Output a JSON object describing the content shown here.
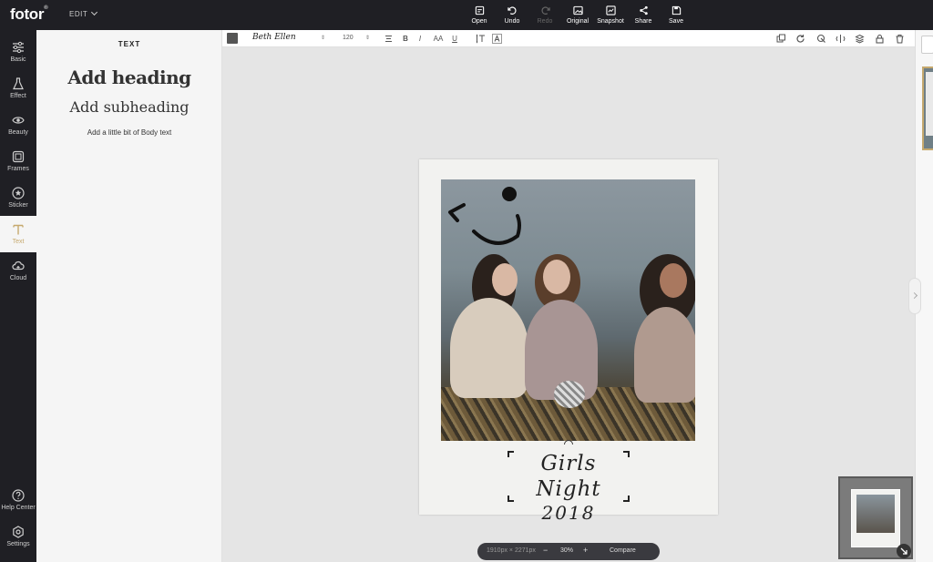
{
  "app": {
    "logo": "fotor",
    "logo_mark": "®",
    "mode_menu": "EDIT"
  },
  "toolbar": [
    {
      "label": "Open",
      "icon": "open-icon",
      "enabled": true
    },
    {
      "label": "Undo",
      "icon": "undo-icon",
      "enabled": true
    },
    {
      "label": "Redo",
      "icon": "redo-icon",
      "enabled": false
    },
    {
      "label": "Original",
      "icon": "original-icon",
      "enabled": true
    },
    {
      "label": "Snapshot",
      "icon": "snapshot-icon",
      "enabled": true
    },
    {
      "label": "Share",
      "icon": "share-icon",
      "enabled": true
    },
    {
      "label": "Save",
      "icon": "save-icon",
      "enabled": true
    }
  ],
  "sidebar": {
    "items": [
      {
        "label": "Basic",
        "icon": "sliders-icon"
      },
      {
        "label": "Effect",
        "icon": "flask-icon"
      },
      {
        "label": "Beauty",
        "icon": "eye-icon"
      },
      {
        "label": "Frames",
        "icon": "frame-icon"
      },
      {
        "label": "Sticker",
        "icon": "star-icon"
      },
      {
        "label": "Text",
        "icon": "text-t-icon",
        "active": true
      },
      {
        "label": "Cloud",
        "icon": "cloud-icon"
      }
    ],
    "bottom": [
      {
        "label": "Help Center",
        "icon": "help-icon"
      },
      {
        "label": "Settings",
        "icon": "settings-icon"
      }
    ]
  },
  "text_panel": {
    "title": "TEXT",
    "heading": "Add heading",
    "subheading": "Add subheading",
    "body": "Add a little bit of Body text"
  },
  "text_toolbar": {
    "color": "#555555",
    "font": "Beth Ellen",
    "size": "120",
    "format_buttons": [
      "B",
      "I",
      "AA",
      "U"
    ]
  },
  "canvas": {
    "caption_line1": "Girls Night",
    "caption_line2": "2018"
  },
  "zoom": {
    "dimensions": "1910px × 2271px",
    "minus": "−",
    "level": "30%",
    "plus": "+",
    "compare": "Compare"
  },
  "colors": {
    "accent": "#c6a96e",
    "chrome": "#1f1f24",
    "panel": "#f5f5f5",
    "workspace": "#e5e5e5"
  }
}
